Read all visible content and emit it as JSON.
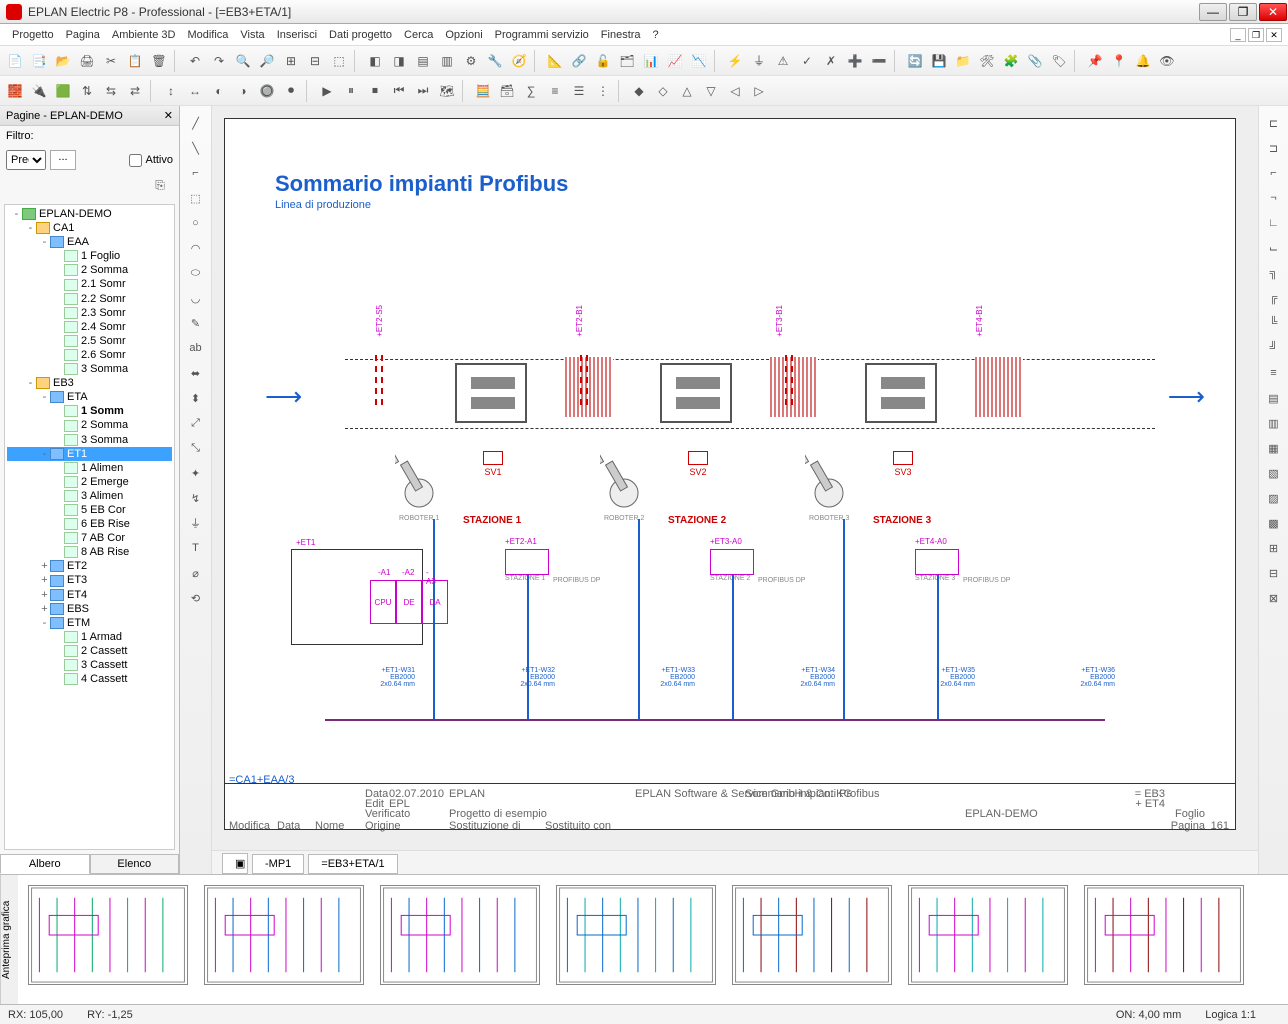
{
  "window": {
    "title": "EPLAN Electric P8 - Professional - [=EB3+ETA/1]"
  },
  "menu": [
    "Progetto",
    "Pagina",
    "Ambiente 3D",
    "Modifica",
    "Vista",
    "Inserisci",
    "Dati progetto",
    "Cerca",
    "Opzioni",
    "Programmi servizio",
    "Finestra",
    "?"
  ],
  "leftpanel": {
    "header": "Pagine - EPLAN-DEMO",
    "filter_label": "Filtro:",
    "filter_select": "Prec",
    "filter_dots": "...",
    "filter_active": "Attivo"
  },
  "tree": {
    "root": "EPLAN-DEMO",
    "nodes": [
      {
        "lvl": 1,
        "tw": "-",
        "icon": "loc",
        "label": "CA1"
      },
      {
        "lvl": 2,
        "tw": "-",
        "icon": "func",
        "label": "EAA"
      },
      {
        "lvl": 3,
        "icon": "page",
        "label": "1 Foglio"
      },
      {
        "lvl": 3,
        "icon": "page",
        "label": "2 Somma"
      },
      {
        "lvl": 3,
        "icon": "page",
        "label": "2.1 Somr"
      },
      {
        "lvl": 3,
        "icon": "page",
        "label": "2.2 Somr"
      },
      {
        "lvl": 3,
        "icon": "page",
        "label": "2.3 Somr"
      },
      {
        "lvl": 3,
        "icon": "page",
        "label": "2.4 Somr"
      },
      {
        "lvl": 3,
        "icon": "page",
        "label": "2.5 Somr"
      },
      {
        "lvl": 3,
        "icon": "page",
        "label": "2.6 Somr"
      },
      {
        "lvl": 3,
        "icon": "page",
        "label": "3 Somma"
      },
      {
        "lvl": 1,
        "tw": "-",
        "icon": "loc",
        "label": "EB3"
      },
      {
        "lvl": 2,
        "tw": "-",
        "icon": "func",
        "label": "ETA"
      },
      {
        "lvl": 3,
        "icon": "page",
        "label": "1 Somm",
        "bold": true
      },
      {
        "lvl": 3,
        "icon": "page",
        "label": "2 Somma"
      },
      {
        "lvl": 3,
        "icon": "page",
        "label": "3 Somma"
      },
      {
        "lvl": 2,
        "tw": "-",
        "icon": "func",
        "label": "ET1",
        "sel": true
      },
      {
        "lvl": 3,
        "icon": "page",
        "label": "1 Alimen"
      },
      {
        "lvl": 3,
        "icon": "page",
        "label": "2 Emerge"
      },
      {
        "lvl": 3,
        "icon": "page",
        "label": "3 Alimen"
      },
      {
        "lvl": 3,
        "icon": "page",
        "label": "5 EB Cor"
      },
      {
        "lvl": 3,
        "icon": "page",
        "label": "6 EB Rise"
      },
      {
        "lvl": 3,
        "icon": "page",
        "label": "7 AB Cor"
      },
      {
        "lvl": 3,
        "icon": "page",
        "label": "8 AB Rise"
      },
      {
        "lvl": 2,
        "tw": "+",
        "icon": "func",
        "label": "ET2"
      },
      {
        "lvl": 2,
        "tw": "+",
        "icon": "func",
        "label": "ET3"
      },
      {
        "lvl": 2,
        "tw": "+",
        "icon": "func",
        "label": "ET4"
      },
      {
        "lvl": 2,
        "tw": "+",
        "icon": "func",
        "label": "EBS"
      },
      {
        "lvl": 2,
        "tw": "-",
        "icon": "func",
        "label": "ETM"
      },
      {
        "lvl": 3,
        "icon": "page",
        "label": "1 Armad"
      },
      {
        "lvl": 3,
        "icon": "page",
        "label": "2 Cassett"
      },
      {
        "lvl": 3,
        "icon": "page",
        "label": "3 Cassett"
      },
      {
        "lvl": 3,
        "icon": "page",
        "label": "4 Cassett"
      }
    ]
  },
  "tree_tabs": {
    "tree": "Albero",
    "list": "Elenco"
  },
  "sheet": {
    "title": "Sommario impianti Profibus",
    "subtitle": "Linea di produzione",
    "stations": [
      "STAZIONE 1",
      "STAZIONE 2",
      "STAZIONE 3"
    ],
    "sv": [
      "SV1",
      "SV2",
      "SV3"
    ],
    "sensors": [
      "+ET2-S5",
      "+ET2-B1",
      "+ET3-B1",
      "+ET4-B1"
    ],
    "robots": [
      "ROBOTER 1",
      "ROBOTER 2",
      "ROBOTER 3"
    ],
    "plc_header": "+ET1",
    "plc_slot_labels": [
      "-A1",
      "-A2",
      "-A3"
    ],
    "plc_cells": [
      "CPU",
      "DE",
      "DA"
    ],
    "et_boxes": [
      {
        "tag": "+ET2-A1",
        "sub": "STAZIONE 1"
      },
      {
        "tag": "+ET3-A0",
        "sub": "STAZIONE 2"
      },
      {
        "tag": "+ET4-A0",
        "sub": "STAZIONE 3"
      }
    ],
    "et_rside": "PROFIBUS DP",
    "wires": [
      {
        "tag": "+ET1-W31",
        "len": "EB2000",
        "note": "2x0.64 mm"
      },
      {
        "tag": "+ET1-W32",
        "len": "EB2000",
        "note": "2x0.64 mm"
      },
      {
        "tag": "+ET1-W33",
        "len": "EB2000",
        "note": "2x0.64 mm"
      },
      {
        "tag": "+ET1-W34",
        "len": "EB2000",
        "note": "2x0.64 mm"
      },
      {
        "tag": "+ET1-W35",
        "len": "EB2000",
        "note": "2x0.64 mm"
      },
      {
        "tag": "+ET1-W36",
        "len": "EB2000",
        "note": "2x0.64 mm"
      }
    ],
    "titleblock": {
      "ref": "=CA1+EAA/3",
      "date_lbl": "Data",
      "date": "02.07.2010",
      "edit_lbl": "Edit",
      "edit": "EPL",
      "ver_lbl": "Verificato",
      "company": "EPLAN",
      "desc": "Progetto di esempio",
      "mod_lbl": "Modifica",
      "data2_lbl": "Data",
      "nome_lbl": "Nome",
      "orig_lbl": "Origine",
      "sost_lbl": "Sostituzione di",
      "sost2_lbl": "Sostituito con",
      "sw": "EPLAN Software & Service GmbH & Co. KG",
      "pagetitle": "Sommario impianti Profibus",
      "proj_lbl": "EPLAN-DEMO",
      "loc1": "= EB3",
      "loc2": "+ ET4",
      "foglio_lbl": "Foglio",
      "foglio": "161",
      "pagina_lbl": "Pagina"
    }
  },
  "doc_tabs": {
    "mp": "-MP1",
    "page": "=EB3+ETA/1"
  },
  "thumb_label": "Anteprima grafica",
  "status": {
    "rx_label": "RX:",
    "rx": "105,00",
    "ry_label": "RY:",
    "ry": "-1,25",
    "on_label": "ON:",
    "on": "4,00 mm",
    "logic": "Logica 1:1"
  }
}
